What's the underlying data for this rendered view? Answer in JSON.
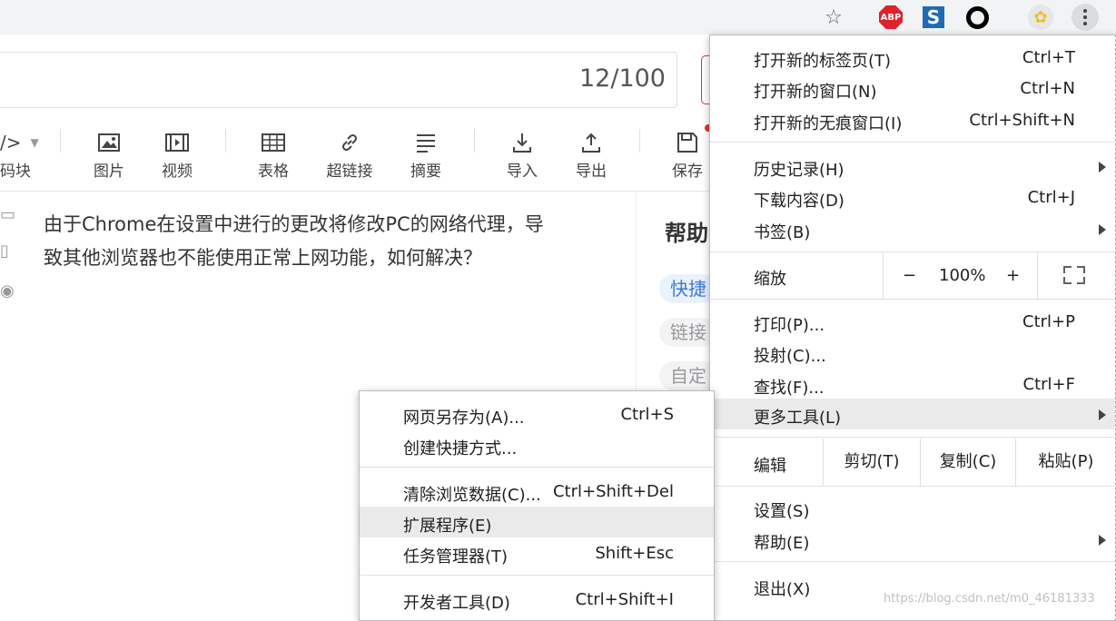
{
  "title_counter": "12/100",
  "toolbar": {
    "code_label": "码块",
    "image": "图片",
    "video": "视频",
    "table": "表格",
    "link": "超链接",
    "summary": "摘要",
    "import": "导入",
    "export": "导出",
    "save": "保存"
  },
  "editor": {
    "line1": "由于Chrome在设置中进行的更改将修改PC的网络代理，导",
    "line2": "致其他浏览器也不能使用正常上网功能，如何解决？"
  },
  "help": {
    "title": "帮助",
    "tags": [
      "快捷",
      "链接",
      "自定"
    ]
  },
  "extensions": {
    "abp": "ABP",
    "s": "S"
  },
  "main_menu": {
    "new_tab": {
      "label": "打开新的标签页(T)",
      "shortcut": "Ctrl+T"
    },
    "new_window": {
      "label": "打开新的窗口(N)",
      "shortcut": "Ctrl+N"
    },
    "incognito": {
      "label": "打开新的无痕窗口(I)",
      "shortcut": "Ctrl+Shift+N"
    },
    "history": {
      "label": "历史记录(H)"
    },
    "downloads": {
      "label": "下载内容(D)",
      "shortcut": "Ctrl+J"
    },
    "bookmarks": {
      "label": "书签(B)"
    },
    "zoom": {
      "label": "缩放",
      "minus": "−",
      "value": "100%",
      "plus": "+"
    },
    "print": {
      "label": "打印(P)...",
      "shortcut": "Ctrl+P"
    },
    "cast": {
      "label": "投射(C)..."
    },
    "find": {
      "label": "查找(F)...",
      "shortcut": "Ctrl+F"
    },
    "more_tools": {
      "label": "更多工具(L)"
    },
    "edit": {
      "label": "编辑",
      "cut": "剪切(T)",
      "copy": "复制(C)",
      "paste": "粘贴(P)"
    },
    "settings": {
      "label": "设置(S)"
    },
    "help": {
      "label": "帮助(E)"
    },
    "exit": {
      "label": "退出(X)"
    }
  },
  "sub_menu": {
    "save_as": {
      "label": "网页另存为(A)...",
      "shortcut": "Ctrl+S"
    },
    "create_shortcut": {
      "label": "创建快捷方式..."
    },
    "clear_data": {
      "label": "清除浏览数据(C)...",
      "shortcut": "Ctrl+Shift+Del"
    },
    "extensions": {
      "label": "扩展程序(E)"
    },
    "task_manager": {
      "label": "任务管理器(T)",
      "shortcut": "Shift+Esc"
    },
    "devtools": {
      "label": "开发者工具(D)",
      "shortcut": "Ctrl+Shift+I"
    }
  },
  "watermark": "https://blog.csdn.net/m0_46181333"
}
